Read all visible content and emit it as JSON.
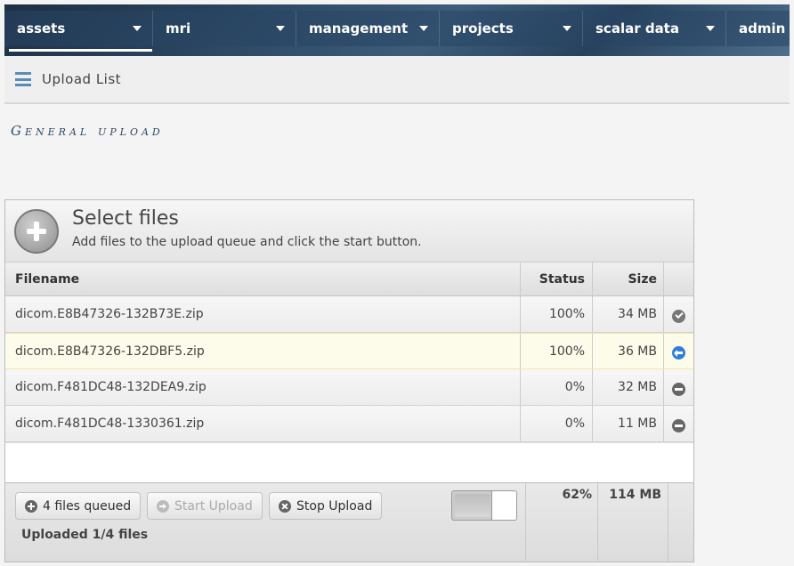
{
  "nav": {
    "items": [
      {
        "label": "assets",
        "active": true,
        "dropdown": true
      },
      {
        "label": "mri",
        "active": false,
        "dropdown": true
      },
      {
        "label": "management",
        "active": false,
        "dropdown": true
      },
      {
        "label": "projects",
        "active": false,
        "dropdown": true
      },
      {
        "label": "scalar data",
        "active": false,
        "dropdown": true
      },
      {
        "label": "admin",
        "active": false,
        "dropdown": false
      }
    ]
  },
  "subheader": {
    "icon": "menu-icon",
    "title": "Upload List"
  },
  "page": {
    "title": "General upload"
  },
  "uploader": {
    "header": {
      "title": "Select files",
      "subtitle": "Add files to the upload queue and click the start button."
    },
    "columns": {
      "filename": "Filename",
      "status": "Status",
      "size": "Size"
    },
    "files": [
      {
        "name": "dicom.E8B47326-132B73E.zip",
        "status": "100%",
        "size": "34 MB",
        "icon": "check-icon",
        "highlight": false
      },
      {
        "name": "dicom.E8B47326-132DBF5.zip",
        "status": "100%",
        "size": "36 MB",
        "icon": "back-arrow-icon",
        "highlight": true
      },
      {
        "name": "dicom.F481DC48-132DEA9.zip",
        "status": "0%",
        "size": "32 MB",
        "icon": "remove-icon",
        "highlight": false
      },
      {
        "name": "dicom.F481DC48-1330361.zip",
        "status": "0%",
        "size": "11 MB",
        "icon": "remove-icon",
        "highlight": false
      }
    ],
    "footer": {
      "queued_label": "4 files queued",
      "start_label": "Start Upload",
      "stop_label": "Stop Upload",
      "uploaded_text": "Uploaded 1/4 files",
      "total_percent": "62%",
      "total_size": "114 MB"
    }
  },
  "colors": {
    "nav_bg": "#2c4762",
    "accent": "#5a8ab8",
    "title": "#2e4a66",
    "active_icon": "#2f7fd8"
  }
}
